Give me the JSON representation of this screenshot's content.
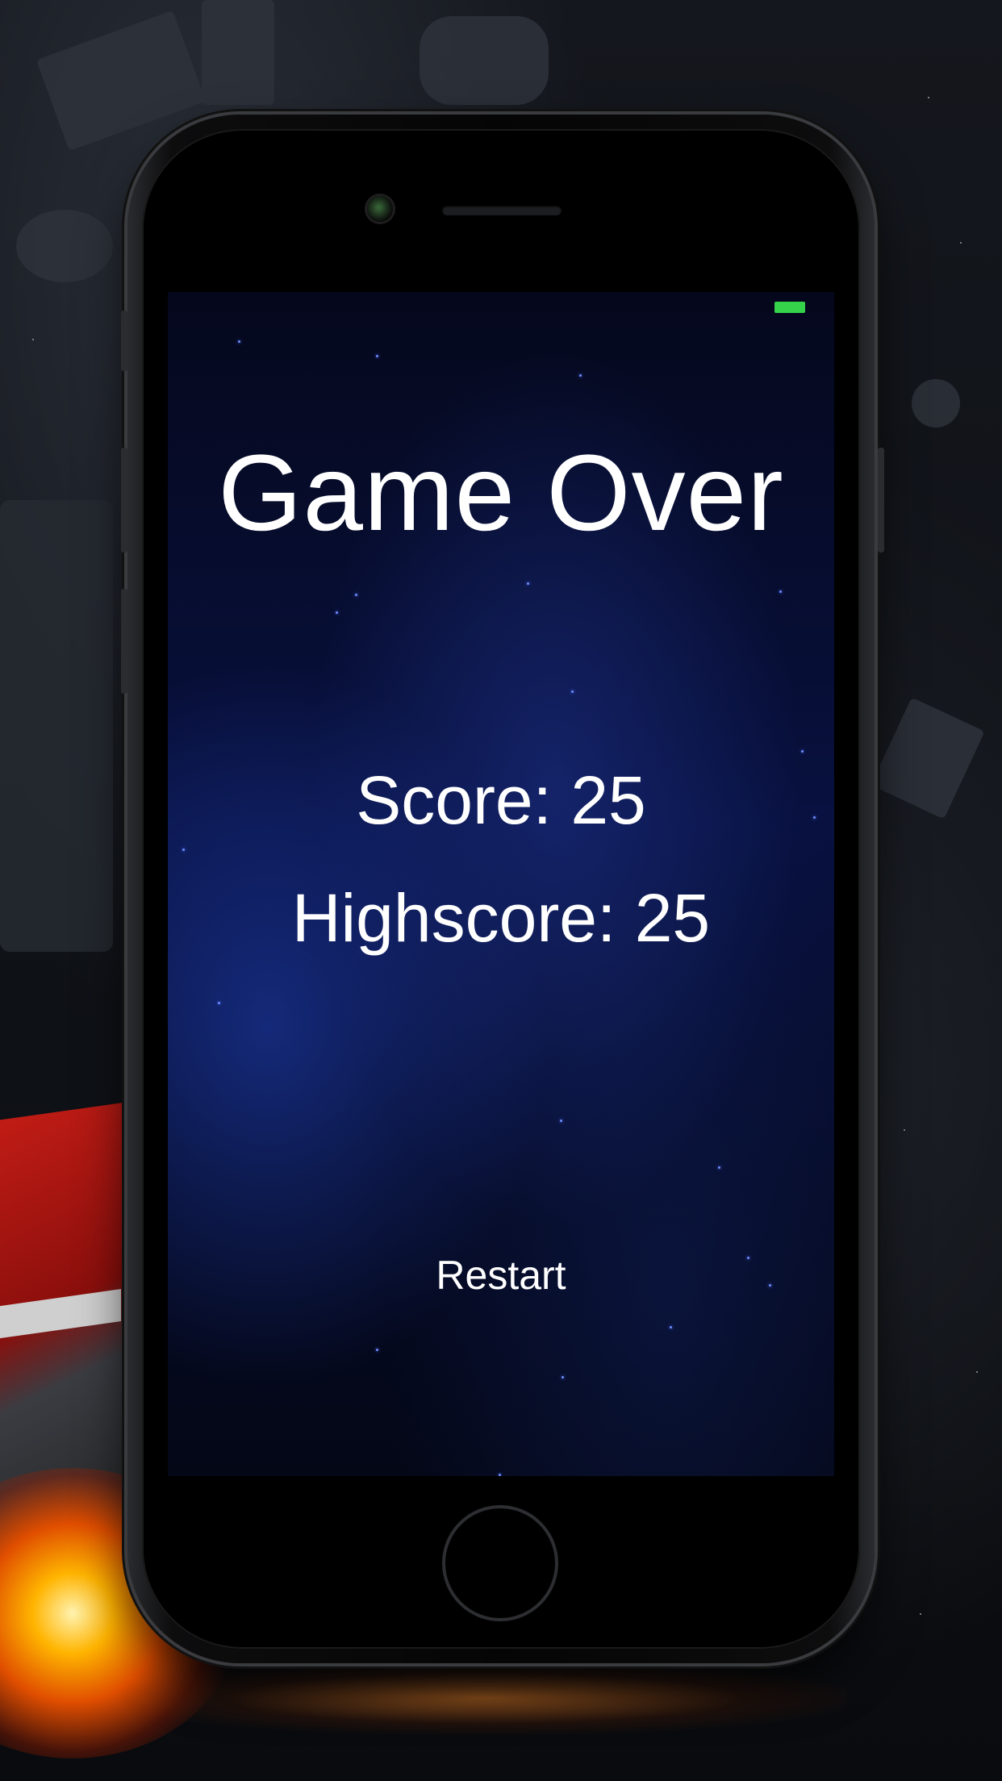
{
  "game": {
    "title": "Game Over",
    "score_text": "Score: 25",
    "highscore_text": "Highscore: 25",
    "restart_label": "Restart"
  },
  "status_bar": {
    "battery_color": "#35d34a"
  },
  "colors": {
    "text": "#ffffff",
    "screen_background": "#081140",
    "backdrop": "#14171d",
    "phone_body": "#050505"
  }
}
